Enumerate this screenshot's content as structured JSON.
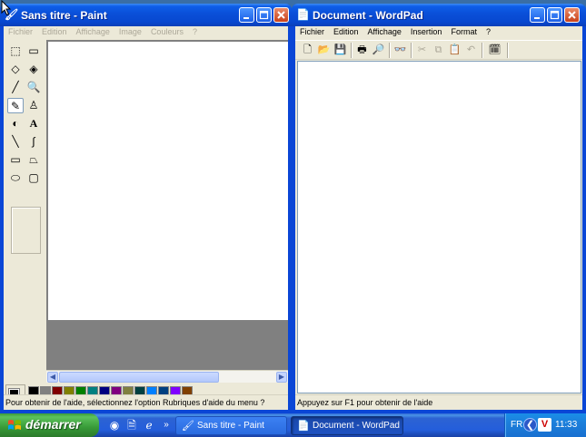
{
  "paint": {
    "title": "Sans titre - Paint",
    "menus": [
      "Fichier",
      "Edition",
      "Affichage",
      "Image",
      "Couleurs",
      "?"
    ],
    "status": "Pour obtenir de l'aide, sélectionnez l'option Rubriques d'aide du menu ?",
    "palette_row1": [
      "#000000",
      "#808080",
      "#800000",
      "#808000",
      "#008000",
      "#008080",
      "#000080",
      "#800080",
      "#808040",
      "#004040",
      "#0080ff",
      "#004080",
      "#8000ff",
      "#804000"
    ],
    "palette_row2": [
      "#ffffff",
      "#c0c0c0",
      "#ff0000",
      "#ffff00",
      "#00ff00",
      "#00ffff",
      "#0000ff",
      "#ff00ff",
      "#ffff80",
      "#00ff80",
      "#80ffff",
      "#8080ff",
      "#ff0080",
      "#ff8040"
    ]
  },
  "wordpad": {
    "title": "Document - WordPad",
    "menus": [
      "Fichier",
      "Edition",
      "Affichage",
      "Insertion",
      "Format",
      "?"
    ],
    "status": "Appuyez sur F1 pour obtenir de l'aide"
  },
  "taskbar": {
    "start_label": "démarrer",
    "buttons": [
      "Sans titre - Paint",
      "Document - WordPad"
    ],
    "chevron": "»",
    "lang": "FR",
    "clock": "11:33"
  }
}
